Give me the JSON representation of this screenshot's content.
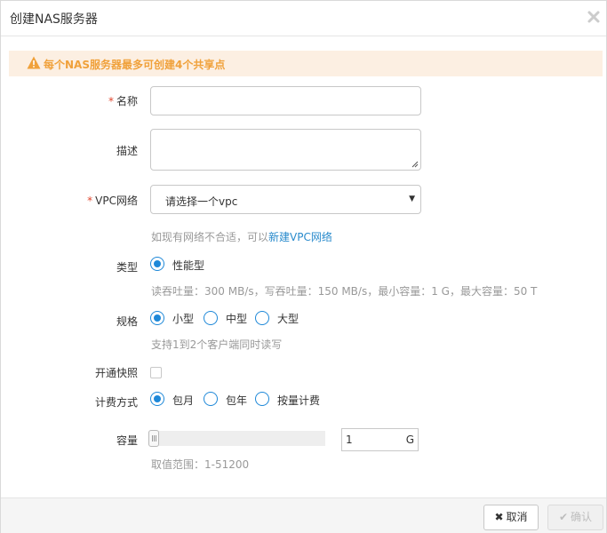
{
  "dialog": {
    "title": "创建NAS服务器",
    "close_icon": "close-icon"
  },
  "alert": {
    "icon": "warning-icon",
    "text": "每个NAS服务器最多可创建4个共享点",
    "color": "#f0a13b",
    "background": "#fcefe2"
  },
  "form": {
    "name": {
      "required_mark": "*",
      "label": "名称",
      "value": ""
    },
    "description": {
      "label": "描述",
      "value": ""
    },
    "vpc": {
      "required_mark": "*",
      "label": "VPC网络",
      "selected": "请选择一个vpc",
      "hint_prefix": "如现有网络不合适，可以",
      "hint_link": "新建VPC网络"
    },
    "type": {
      "label": "类型",
      "options": [
        "性能型"
      ],
      "selected": "性能型",
      "hint": "读吞吐量：300 MB/s，写吞吐量：150 MB/s，最小容量：1 G，最大容量：50 T"
    },
    "spec": {
      "label": "规格",
      "options": [
        "小型",
        "中型",
        "大型"
      ],
      "selected": "小型",
      "hint": "支持1到2个客户端同时读写"
    },
    "snapshot": {
      "label": "开通快照",
      "checked": false
    },
    "billing": {
      "label": "计费方式",
      "options": [
        "包月",
        "包年",
        "按量计费"
      ],
      "selected": "包月"
    },
    "capacity": {
      "label": "容量",
      "value": "1",
      "unit": "G",
      "slider_fraction": 0,
      "hint": "取值范围：1-51200"
    }
  },
  "footer": {
    "cancel_label": "取消",
    "cancel_icon": "times-icon",
    "confirm_label": "确认",
    "confirm_icon": "check-icon"
  },
  "colors": {
    "accent": "#1e88d8",
    "link": "#2a8bcc",
    "required": "#e0462e"
  }
}
